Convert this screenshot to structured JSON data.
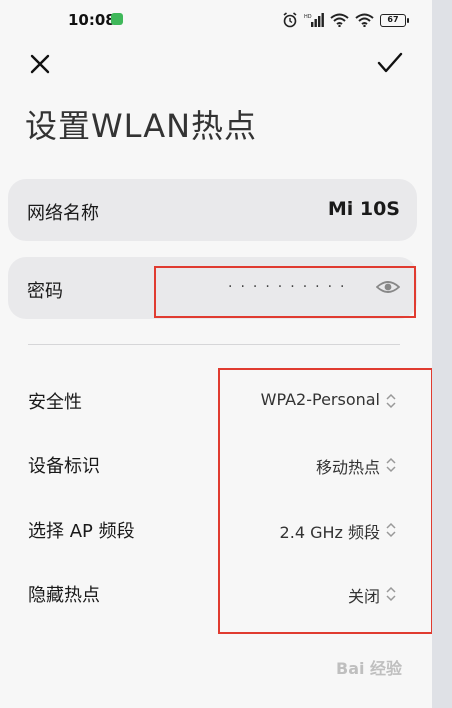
{
  "status_bar": {
    "time": "10:08",
    "battery": "67"
  },
  "header": {
    "close_icon": "close-icon",
    "confirm_icon": "check-icon",
    "title": "设置WLAN热点"
  },
  "fields": {
    "network_name_label": "网络名称",
    "network_name_value": "Mi 10S",
    "password_label": "密码",
    "password_mask": "··········"
  },
  "settings": [
    {
      "label": "安全性",
      "value": "WPA2-Personal"
    },
    {
      "label": "设备标识",
      "value": "移动热点"
    },
    {
      "label": "选择 AP 频段",
      "value": "2.4 GHz 频段"
    },
    {
      "label": "隐藏热点",
      "value": "关闭"
    }
  ],
  "watermark": "Bai 经验",
  "colors": {
    "highlight": "#e03b30",
    "field_bg": "#e9e9eb",
    "page_bg": "#f7f7f7"
  }
}
